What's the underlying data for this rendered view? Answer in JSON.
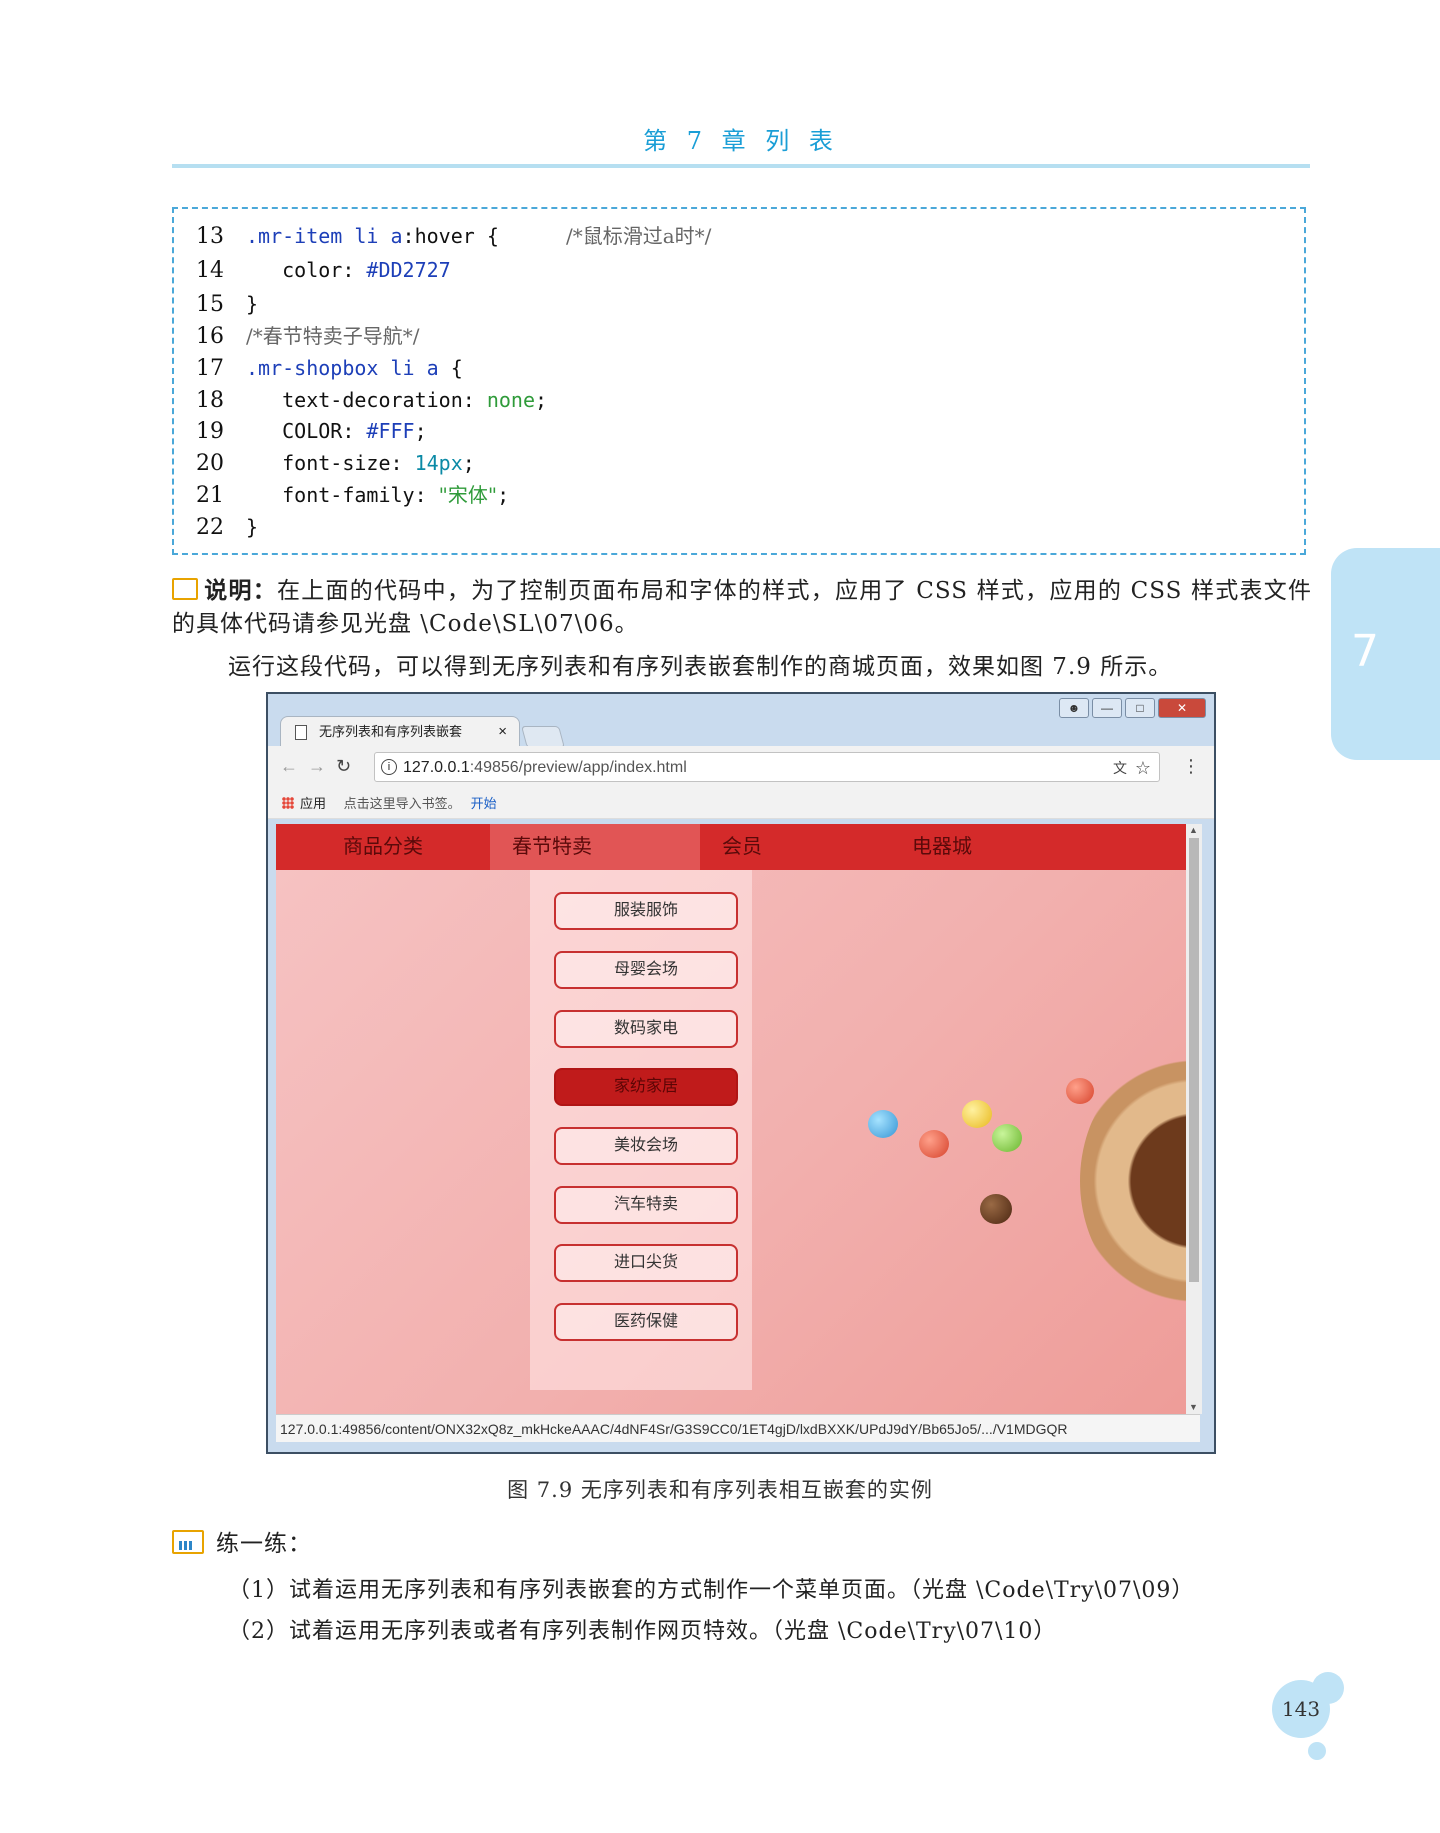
{
  "header": {
    "chapter": "第 7 章    列    表"
  },
  "side_tab": {
    "number": "7"
  },
  "code": {
    "lines": [
      {
        "num": "13",
        "selector": ".mr-item li a",
        "pseudo": ":hover",
        "rest": " {",
        "comment": "/*鼠标滑过a时*/"
      },
      {
        "num": "14",
        "prop": "color: ",
        "value": "#DD2727"
      },
      {
        "num": "15",
        "text": "}"
      },
      {
        "num": "16",
        "comment": "/*春节特卖子导航*/"
      },
      {
        "num": "17",
        "selector": ".mr-shopbox li a",
        "rest": " {"
      },
      {
        "num": "18",
        "prop": "text-decoration: ",
        "value": "none",
        "end": ";"
      },
      {
        "num": "19",
        "prop": "COLOR: ",
        "value": "#FFF",
        "end": ";"
      },
      {
        "num": "20",
        "prop": "font-size: ",
        "value": "14px",
        "end": ";"
      },
      {
        "num": "21",
        "prop": "font-family: ",
        "value": "\"宋体\"",
        "end": ";"
      },
      {
        "num": "22",
        "text": "}"
      }
    ]
  },
  "note": {
    "label": "说明：",
    "text": "在上面的代码中，为了控制页面布局和字体的样式，应用了 CSS 样式，应用的 CSS 样式表文件的具体代码请参见光盘 \\Code\\SL\\07\\06。"
  },
  "paragraph": "运行这段代码，可以得到无序列表和有序列表嵌套制作的商城页面，效果如图 7.9 所示。",
  "browser": {
    "tab_title": "无序列表和有序列表嵌套",
    "tab_close": "×",
    "url_host": "127.0.0.1",
    "url_rest": ":49856/preview/app/index.html",
    "bookmarks_apps": "应用",
    "bookmarks_hint": "点击这里导入书签。",
    "bookmarks_link": "开始",
    "nav_items": [
      "商品分类",
      "春节特卖",
      "会员",
      "电器城"
    ],
    "sub_items": [
      "服装服饰",
      "母婴会场",
      "数码家电",
      "家纺家居",
      "美妆会场",
      "汽车特卖",
      "进口尖货",
      "医药保健"
    ],
    "active_sub_index": 3,
    "status_url": "127.0.0.1:49856/content/ONX32xQ8z_mkHckeAAAC/4dNF4Sr/G3S9CC0/1ET4gjD/lxdBXXK/UPdJ9dY/Bb65Jo5/.../V1MDGQR"
  },
  "caption": "图 7.9    无序列表和有序列表相互嵌套的实例",
  "practice": {
    "title": "练一练：",
    "items": [
      "（1）试着运用无序列表和有序列表嵌套的方式制作一个菜单页面。（光盘 \\Code\\Try\\07\\09）",
      "（2）试着运用无序列表或者有序列表制作网页特效。（光盘 \\Code\\Try\\07\\10）"
    ]
  },
  "page_number": "143",
  "colors": {
    "accent": "#1a9ed6",
    "nav_red": "#d42a2a",
    "active_red": "#c01b1b"
  }
}
